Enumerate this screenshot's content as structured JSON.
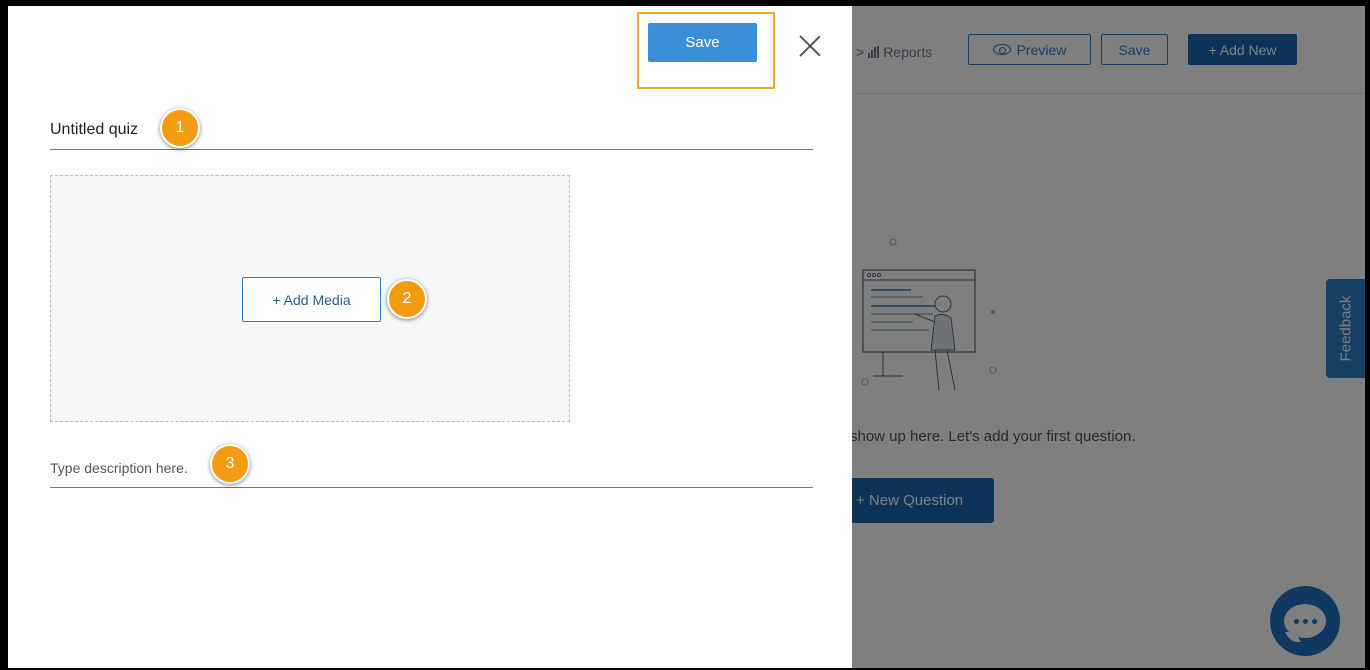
{
  "background_app": {
    "breadcrumb_separator": ">",
    "reports_label": "Reports",
    "preview_label": "Preview",
    "save_label": "Save",
    "add_new_label": "+ Add New",
    "empty_state_text": "show up here. Let's add your first question.",
    "new_question_label": "+ New Question",
    "feedback_label": "Feedback"
  },
  "modal": {
    "save_label": "Save",
    "title_value": "Untitled quiz",
    "add_media_label": "+ Add Media",
    "description_placeholder": "Type description here."
  },
  "step_badges": [
    "1",
    "2",
    "3"
  ],
  "colors": {
    "primary": "#3b8fd9",
    "primary_dark": "#1a67b3",
    "highlight": "#f5a623",
    "badge": "#f39c12"
  }
}
